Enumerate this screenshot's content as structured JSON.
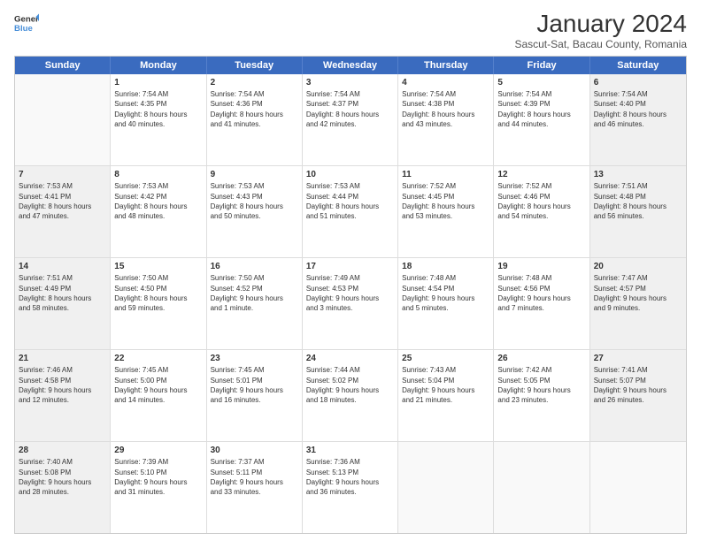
{
  "header": {
    "logo_general": "General",
    "logo_blue": "Blue",
    "title": "January 2024",
    "subtitle": "Sascut-Sat, Bacau County, Romania"
  },
  "days": [
    "Sunday",
    "Monday",
    "Tuesday",
    "Wednesday",
    "Thursday",
    "Friday",
    "Saturday"
  ],
  "weeks": [
    [
      {
        "day": "",
        "sunrise": "",
        "sunset": "",
        "daylight": "",
        "empty": true
      },
      {
        "day": "1",
        "sunrise": "7:54 AM",
        "sunset": "4:35 PM",
        "daylight": "8 hours and 40 minutes.",
        "empty": false
      },
      {
        "day": "2",
        "sunrise": "7:54 AM",
        "sunset": "4:36 PM",
        "daylight": "8 hours and 41 minutes.",
        "empty": false
      },
      {
        "day": "3",
        "sunrise": "7:54 AM",
        "sunset": "4:37 PM",
        "daylight": "8 hours and 42 minutes.",
        "empty": false
      },
      {
        "day": "4",
        "sunrise": "7:54 AM",
        "sunset": "4:38 PM",
        "daylight": "8 hours and 43 minutes.",
        "empty": false
      },
      {
        "day": "5",
        "sunrise": "7:54 AM",
        "sunset": "4:39 PM",
        "daylight": "8 hours and 44 minutes.",
        "empty": false
      },
      {
        "day": "6",
        "sunrise": "7:54 AM",
        "sunset": "4:40 PM",
        "daylight": "8 hours and 46 minutes.",
        "empty": false
      }
    ],
    [
      {
        "day": "7",
        "sunrise": "7:53 AM",
        "sunset": "4:41 PM",
        "daylight": "8 hours and 47 minutes.",
        "empty": false
      },
      {
        "day": "8",
        "sunrise": "7:53 AM",
        "sunset": "4:42 PM",
        "daylight": "8 hours and 48 minutes.",
        "empty": false
      },
      {
        "day": "9",
        "sunrise": "7:53 AM",
        "sunset": "4:43 PM",
        "daylight": "8 hours and 50 minutes.",
        "empty": false
      },
      {
        "day": "10",
        "sunrise": "7:53 AM",
        "sunset": "4:44 PM",
        "daylight": "8 hours and 51 minutes.",
        "empty": false
      },
      {
        "day": "11",
        "sunrise": "7:52 AM",
        "sunset": "4:45 PM",
        "daylight": "8 hours and 53 minutes.",
        "empty": false
      },
      {
        "day": "12",
        "sunrise": "7:52 AM",
        "sunset": "4:46 PM",
        "daylight": "8 hours and 54 minutes.",
        "empty": false
      },
      {
        "day": "13",
        "sunrise": "7:51 AM",
        "sunset": "4:48 PM",
        "daylight": "8 hours and 56 minutes.",
        "empty": false
      }
    ],
    [
      {
        "day": "14",
        "sunrise": "7:51 AM",
        "sunset": "4:49 PM",
        "daylight": "8 hours and 58 minutes.",
        "empty": false
      },
      {
        "day": "15",
        "sunrise": "7:50 AM",
        "sunset": "4:50 PM",
        "daylight": "8 hours and 59 minutes.",
        "empty": false
      },
      {
        "day": "16",
        "sunrise": "7:50 AM",
        "sunset": "4:52 PM",
        "daylight": "9 hours and 1 minute.",
        "empty": false
      },
      {
        "day": "17",
        "sunrise": "7:49 AM",
        "sunset": "4:53 PM",
        "daylight": "9 hours and 3 minutes.",
        "empty": false
      },
      {
        "day": "18",
        "sunrise": "7:48 AM",
        "sunset": "4:54 PM",
        "daylight": "9 hours and 5 minutes.",
        "empty": false
      },
      {
        "day": "19",
        "sunrise": "7:48 AM",
        "sunset": "4:56 PM",
        "daylight": "9 hours and 7 minutes.",
        "empty": false
      },
      {
        "day": "20",
        "sunrise": "7:47 AM",
        "sunset": "4:57 PM",
        "daylight": "9 hours and 9 minutes.",
        "empty": false
      }
    ],
    [
      {
        "day": "21",
        "sunrise": "7:46 AM",
        "sunset": "4:58 PM",
        "daylight": "9 hours and 12 minutes.",
        "empty": false
      },
      {
        "day": "22",
        "sunrise": "7:45 AM",
        "sunset": "5:00 PM",
        "daylight": "9 hours and 14 minutes.",
        "empty": false
      },
      {
        "day": "23",
        "sunrise": "7:45 AM",
        "sunset": "5:01 PM",
        "daylight": "9 hours and 16 minutes.",
        "empty": false
      },
      {
        "day": "24",
        "sunrise": "7:44 AM",
        "sunset": "5:02 PM",
        "daylight": "9 hours and 18 minutes.",
        "empty": false
      },
      {
        "day": "25",
        "sunrise": "7:43 AM",
        "sunset": "5:04 PM",
        "daylight": "9 hours and 21 minutes.",
        "empty": false
      },
      {
        "day": "26",
        "sunrise": "7:42 AM",
        "sunset": "5:05 PM",
        "daylight": "9 hours and 23 minutes.",
        "empty": false
      },
      {
        "day": "27",
        "sunrise": "7:41 AM",
        "sunset": "5:07 PM",
        "daylight": "9 hours and 26 minutes.",
        "empty": false
      }
    ],
    [
      {
        "day": "28",
        "sunrise": "7:40 AM",
        "sunset": "5:08 PM",
        "daylight": "9 hours and 28 minutes.",
        "empty": false
      },
      {
        "day": "29",
        "sunrise": "7:39 AM",
        "sunset": "5:10 PM",
        "daylight": "9 hours and 31 minutes.",
        "empty": false
      },
      {
        "day": "30",
        "sunrise": "7:37 AM",
        "sunset": "5:11 PM",
        "daylight": "9 hours and 33 minutes.",
        "empty": false
      },
      {
        "day": "31",
        "sunrise": "7:36 AM",
        "sunset": "5:13 PM",
        "daylight": "9 hours and 36 minutes.",
        "empty": false
      },
      {
        "day": "",
        "sunrise": "",
        "sunset": "",
        "daylight": "",
        "empty": true
      },
      {
        "day": "",
        "sunrise": "",
        "sunset": "",
        "daylight": "",
        "empty": true
      },
      {
        "day": "",
        "sunrise": "",
        "sunset": "",
        "daylight": "",
        "empty": true
      }
    ]
  ],
  "labels": {
    "sunrise_prefix": "Sunrise: ",
    "sunset_prefix": "Sunset: ",
    "daylight_prefix": "Daylight: "
  }
}
